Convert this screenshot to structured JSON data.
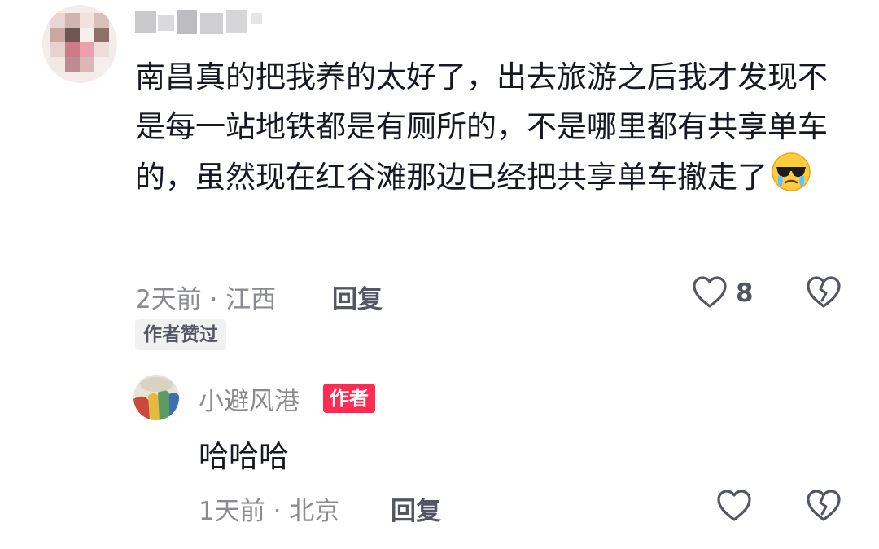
{
  "comment": {
    "username": "",
    "text": "南昌真的把我养的太好了，出去旅游之后我才发现不是每一站地铁都是有厕所的，不是哪里都有共享单车的，虽然现在红谷滩那边已经把共享单车撤走了",
    "emoji": "crying-sunglasses-emoji",
    "meta": "2天前 · 江西",
    "reply_label": "回复",
    "like_count": "8",
    "author_liked_label": "作者赞过"
  },
  "reply": {
    "username": "小避风港",
    "author_badge": "作者",
    "text": "哈哈哈",
    "meta": "1天前 · 北京",
    "reply_label": "回复"
  },
  "colors": {
    "text": "#161823",
    "meta": "#8a8b91",
    "action": "#545663",
    "badge": "#fe2c55"
  }
}
